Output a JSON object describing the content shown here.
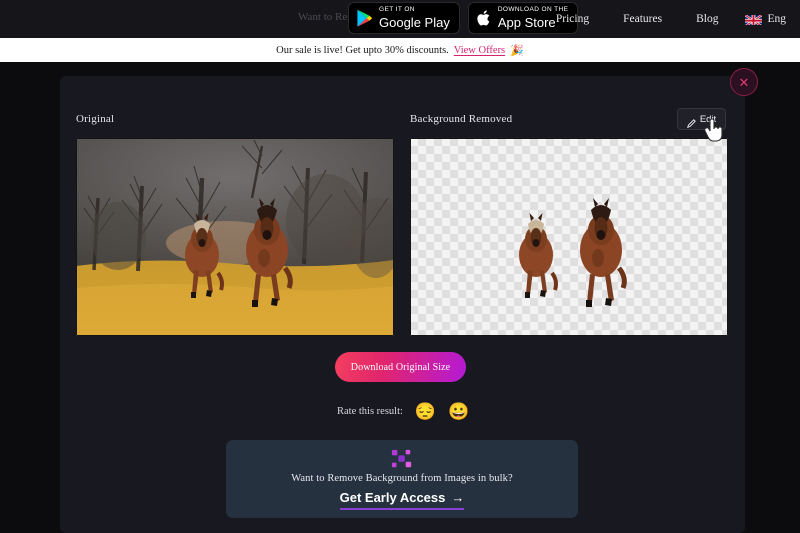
{
  "nav": {
    "hidden_text": "Want to Res",
    "badges": [
      {
        "icon": "google-play-icon",
        "small": "GET IT ON",
        "big": "Google Play"
      },
      {
        "icon": "apple-icon",
        "small": "Download on the",
        "big": "App Store"
      }
    ],
    "links": [
      {
        "label": "Pricing",
        "name": "nav-link-pricing"
      },
      {
        "label": "Features",
        "name": "nav-link-features"
      },
      {
        "label": "Blog",
        "name": "nav-link-blog"
      }
    ],
    "language": {
      "label": "Eng",
      "flag": "uk-flag-icon"
    }
  },
  "sale_banner": {
    "text": "Our sale is live! Get upto 30% discounts.",
    "link": "View Offers",
    "emoji": "🎉"
  },
  "modal": {
    "close_label": "✕",
    "original_label": "Original",
    "removed_label": "Background Removed",
    "edit_label": "Edit",
    "download_label": "Download Original Size",
    "rate_label": "Rate this result:",
    "rate_sad": "😔",
    "rate_happy": "😀",
    "bulk": {
      "title": "Want to Remove Background from Images in bulk?",
      "cta": "Get Early Access",
      "cta_arrow": "→"
    }
  },
  "colors": {
    "accent_pink": "#d6236f",
    "accent_purple": "#8b3fd6",
    "close_red": "#e0396f",
    "card_bg": "#26313f",
    "modal_bg": "#181820"
  }
}
